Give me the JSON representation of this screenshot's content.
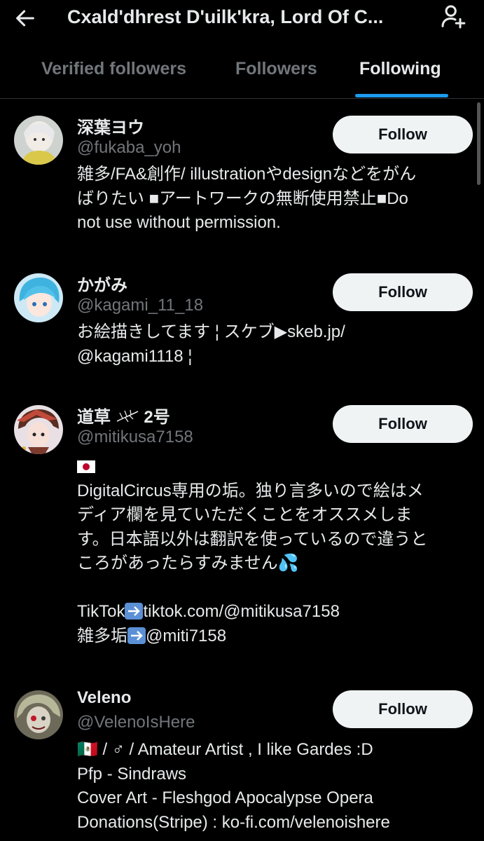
{
  "header": {
    "title": "Cxald'dhrest D'uilk'kra, Lord Of C...",
    "back_icon": "arrow-left-icon",
    "add_user_icon": "person-add-icon"
  },
  "tabs": [
    {
      "label": "Verified followers",
      "active": false
    },
    {
      "label": "Followers",
      "active": false
    },
    {
      "label": "Following",
      "active": true
    }
  ],
  "colors": {
    "accent": "#1d9bf0",
    "background": "#000000",
    "secondary_text": "#71767b"
  },
  "users": [
    {
      "name": "深葉ヨウ",
      "handle": "@fukaba_yoh",
      "follow_label": "Follow",
      "bio_lines": [
        "雑多/FA&創作/ illustrationやdesignなどをがん",
        "ばりたい ■アートワークの無断使用禁止■Do",
        "not use without permission."
      ]
    },
    {
      "name": "かがみ",
      "handle": "@kagami_11_18",
      "follow_label": "Follow",
      "bio_lines": [
        "お絵描きしてます ¦ スケブ▶skeb.jp/",
        "@kagami1118 ¦"
      ]
    },
    {
      "name": "道草",
      "name_suffix": "2号",
      "handle": "@mitikusa7158",
      "follow_label": "Follow",
      "flag_line": "🇯🇵",
      "bio_lines": [
        "DigitalCircus専用の垢。独り言多いので絵はメ",
        "ディア欄を見ていただくことをオススメしま",
        "す。日本語以外は翻訳を使っているので違うと",
        "ころがあったらすみません💦"
      ],
      "links": [
        {
          "prefix": "TikTok",
          "text": "tiktok.com/@mitikusa7158"
        },
        {
          "prefix": "雑多垢",
          "text": "@miti7158"
        }
      ]
    },
    {
      "name": "Veleno",
      "handle": "@VelenoIsHere",
      "follow_label": "Follow",
      "bio_lines": [
        "🇲🇽 /  ♂  / Amateur Artist , I like Gardes :D",
        "Pfp - Sindraws",
        "Cover Art - Fleshgod Apocalypse Opera",
        "Donations(Stripe) : ko-fi.com/velenoishere"
      ]
    }
  ]
}
